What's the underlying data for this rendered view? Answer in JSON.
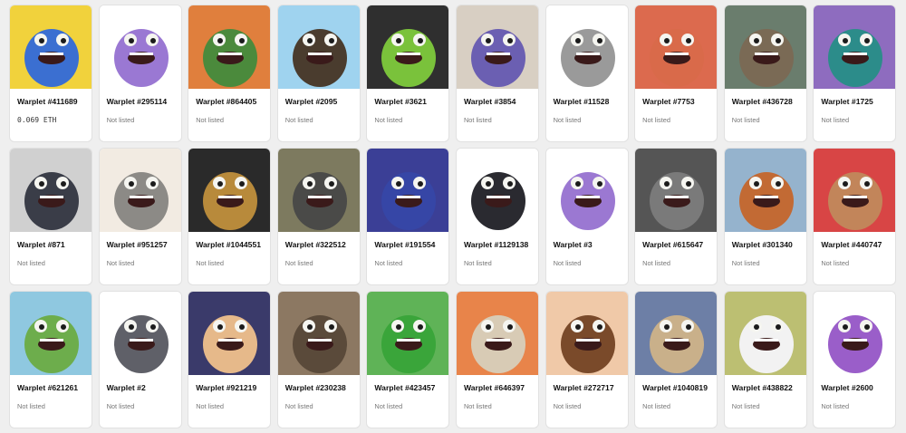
{
  "colors": {
    "page_bg": "#efefef",
    "card_bg": "#ffffff",
    "not_listed": "#777777"
  },
  "items": [
    {
      "name": "Warplet #411689",
      "status": "0.069 ETH",
      "bg": "#f1d23c",
      "body": "#3b6fd1",
      "icon": "ball-monster"
    },
    {
      "name": "Warplet #295114",
      "status": "Not listed",
      "bg": "#ffffff",
      "body": "#9a78d3",
      "icon": "purple-blob-sunglasses"
    },
    {
      "name": "Warplet #864405",
      "status": "Not listed",
      "bg": "#e07f3d",
      "body": "#4b8a3c",
      "icon": "jacket-otter"
    },
    {
      "name": "Warplet #2095",
      "status": "Not listed",
      "bg": "#9fd3ef",
      "body": "#4a3c2e",
      "icon": "dark-blob-glasses"
    },
    {
      "name": "Warplet #3621",
      "status": "Not listed",
      "bg": "#2f2f2f",
      "body": "#7ac23b",
      "icon": "green-monster"
    },
    {
      "name": "Warplet #3854",
      "status": "Not listed",
      "bg": "#d8cfc3",
      "body": "#6b5fb2",
      "icon": "bandana-monster"
    },
    {
      "name": "Warplet #11528",
      "status": "Not listed",
      "bg": "#ffffff",
      "body": "#9a9a9a",
      "icon": "stone-blob"
    },
    {
      "name": "Warplet #7753",
      "status": "Not listed",
      "bg": "#dc6a4e",
      "body": "#d96a4a",
      "icon": "orange-blob"
    },
    {
      "name": "Warplet #436728",
      "status": "Not listed",
      "bg": "#6a7d6d",
      "body": "#7a6a55",
      "icon": "furry-monster"
    },
    {
      "name": "Warplet #1725",
      "status": "Not listed",
      "bg": "#8e6cbf",
      "body": "#2c8c8a",
      "icon": "hooded-monster"
    },
    {
      "name": "Warplet #871",
      "status": "Not listed",
      "bg": "#d0d0d0",
      "body": "#3a3d48",
      "icon": "tv-head-monster"
    },
    {
      "name": "Warplet #951257",
      "status": "Not listed",
      "bg": "#f2ebe2",
      "body": "#8c8a86",
      "icon": "striped-monster"
    },
    {
      "name": "Warplet #1044551",
      "status": "Not listed",
      "bg": "#2a2a2a",
      "body": "#b88a3b",
      "icon": "sweater-monster"
    },
    {
      "name": "Warplet #322512",
      "status": "Not listed",
      "bg": "#7d7a5f",
      "body": "#4a4a48",
      "icon": "jacket-monster"
    },
    {
      "name": "Warplet #191554",
      "status": "Not listed",
      "bg": "#3b3f96",
      "body": "#3646a6",
      "icon": "blue-blob"
    },
    {
      "name": "Warplet #1129138",
      "status": "Not listed",
      "bg": "#ffffff",
      "body": "#2a2a30",
      "icon": "black-cap-blob"
    },
    {
      "name": "Warplet #3",
      "status": "Not listed",
      "bg": "#ffffff",
      "body": "#9b78d2",
      "icon": "pirate-blob"
    },
    {
      "name": "Warplet #615647",
      "status": "Not listed",
      "bg": "#555555",
      "body": "#7a7a7a",
      "icon": "grumpy-blob"
    },
    {
      "name": "Warplet #301340",
      "status": "Not listed",
      "bg": "#95b3cd",
      "body": "#c26a34",
      "icon": "cowboy-blob"
    },
    {
      "name": "Warplet #440747",
      "status": "Not listed",
      "bg": "#d84545",
      "body": "#c2855a",
      "icon": "shades-blob"
    },
    {
      "name": "Warplet #621261",
      "status": "Not listed",
      "bg": "#8fc8e0",
      "body": "#6dad4c",
      "icon": "turtle"
    },
    {
      "name": "Warplet #2",
      "status": "Not listed",
      "bg": "#ffffff",
      "body": "#5f6068",
      "icon": "grey-monster"
    },
    {
      "name": "Warplet #921219",
      "status": "Not listed",
      "bg": "#3a3a6a",
      "body": "#e6b98a",
      "icon": "potato-blob"
    },
    {
      "name": "Warplet #230238",
      "status": "Not listed",
      "bg": "#8c7862",
      "body": "#5a4a3a",
      "icon": "cat-monster"
    },
    {
      "name": "Warplet #423457",
      "status": "Not listed",
      "bg": "#5fb357",
      "body": "#3aa53a",
      "icon": "green-star-monster"
    },
    {
      "name": "Warplet #646397",
      "status": "Not listed",
      "bg": "#e8844a",
      "body": "#d8cbb5",
      "icon": "beige-monster"
    },
    {
      "name": "Warplet #272717",
      "status": "Not listed",
      "bg": "#f0c9a8",
      "body": "#7a4a2a",
      "icon": "bear"
    },
    {
      "name": "Warplet #1040819",
      "status": "Not listed",
      "bg": "#6d7fa6",
      "body": "#c9b08a",
      "icon": "pug"
    },
    {
      "name": "Warplet #438822",
      "status": "Not listed",
      "bg": "#bcbf72",
      "body": "#f2f2f2",
      "icon": "white-hair-blob"
    },
    {
      "name": "Warplet #2600",
      "status": "Not listed",
      "bg": "#ffffff",
      "body": "#9a5ec9",
      "icon": "purple-monster"
    }
  ]
}
